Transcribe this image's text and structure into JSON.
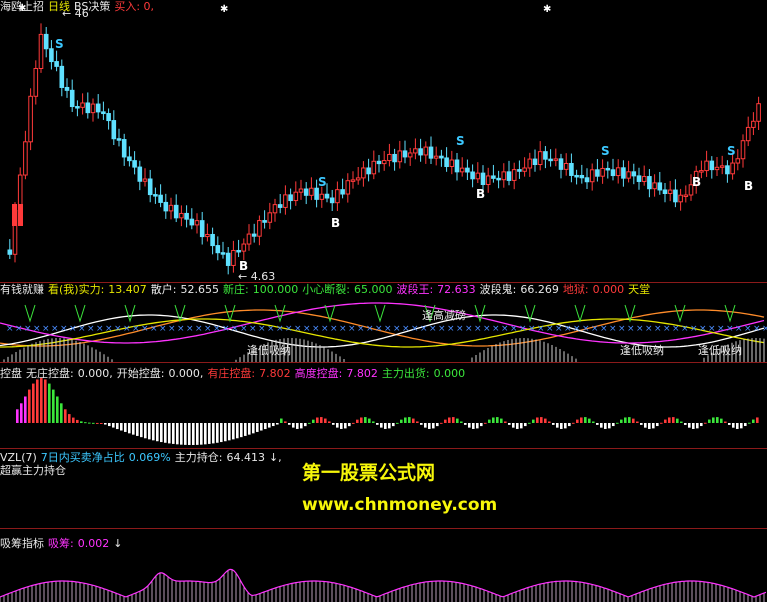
{
  "price_panel": {
    "indicator_prefix": "海鸥上招",
    "period": "日线",
    "strategy": "BS决策",
    "signal": "买入: 0,",
    "high_label": "46",
    "low_label": "4.63",
    "sell_marker": "S",
    "buy_marker": "B",
    "low_marker": "3",
    "up_color": "#ff3a3a",
    "down_color": "#5fe1ff"
  },
  "osc_panel": {
    "title": "有钱就赚",
    "label_watch": "看(我)实力:",
    "val_watch": "13.407",
    "label_retail": "散户:",
    "val_retail": "52.655",
    "label_newzhuang": "新庄:",
    "val_newzhuang": "100.000",
    "label_careful": "小心断裂:",
    "val_careful": "65.000",
    "label_wave_king": "波段王:",
    "val_wave_king": "72.633",
    "label_wave_ghost": "波段鬼:",
    "val_wave_ghost": "66.269",
    "label_hell": "地狱:",
    "val_hell": "0.000",
    "label_heaven": "天堂",
    "tag_high": "逢高减磅",
    "tag_low_1": "逢低吸纳",
    "tag_low_2": "逢低吸纳",
    "tag_low_3": "逢低吸纳"
  },
  "ctrl_panel": {
    "title": "控盘",
    "label_none": "无庄控盘:",
    "val_none": "0.000,",
    "label_start": "开始控盘:",
    "val_start": "0.000,",
    "label_have": "有庄控盘:",
    "val_have": "7.802",
    "label_high": "高度控盘:",
    "val_high": "7.802",
    "label_out": "主力出货:",
    "val_out": "0.000"
  },
  "vol_panel": {
    "title": "VZL(7)",
    "label_net": "7日内买卖净占比",
    "val_net": "0.069%",
    "label_hold": "主力持仓:",
    "val_hold": "64.413",
    "arrow": "↓,",
    "subtitle": "超赢主力持仓"
  },
  "acc_panel": {
    "title": "吸筹指标",
    "label_acc": "吸筹:",
    "val_acc": "0.002",
    "arrow": "↓"
  },
  "watermark": {
    "line1": "第一股票公式网",
    "line2": "www.chnmoney.com"
  }
}
